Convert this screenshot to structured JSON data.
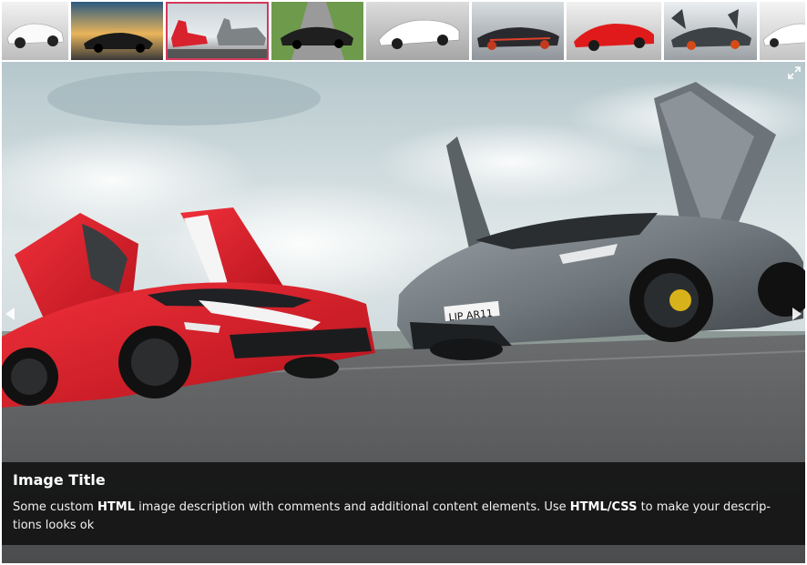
{
  "gallery": {
    "thumbnails": [
      {
        "label": "white-ferrari-thumb",
        "active": false
      },
      {
        "label": "black-car-sunset-thumb",
        "active": false
      },
      {
        "label": "red-and-gray-supercars-thumb",
        "active": true
      },
      {
        "label": "black-car-road-thumb",
        "active": false
      },
      {
        "label": "white-ferrari-side-thumb",
        "active": false
      },
      {
        "label": "black-red-car-thumb",
        "active": false
      },
      {
        "label": "red-ferrari-thumb",
        "active": false
      },
      {
        "label": "lamborghini-doors-up-thumb",
        "active": false
      },
      {
        "label": "white-car-partial-thumb",
        "active": false
      }
    ],
    "caption": {
      "title": "Image Title",
      "text_before_html": "Some custom ",
      "bold_html": "HTML",
      "text_middle": " image description with comments and additional content elements. Use ",
      "bold_css": "HTML/CSS",
      "text_after": " to make your descrip-tions looks ok"
    },
    "colors": {
      "active_border": "#d23a5c",
      "caption_bg": "#141414"
    },
    "icons": {
      "prev": "chevron-left-icon",
      "next": "chevron-right-icon",
      "fullscreen": "expand-icon"
    }
  }
}
